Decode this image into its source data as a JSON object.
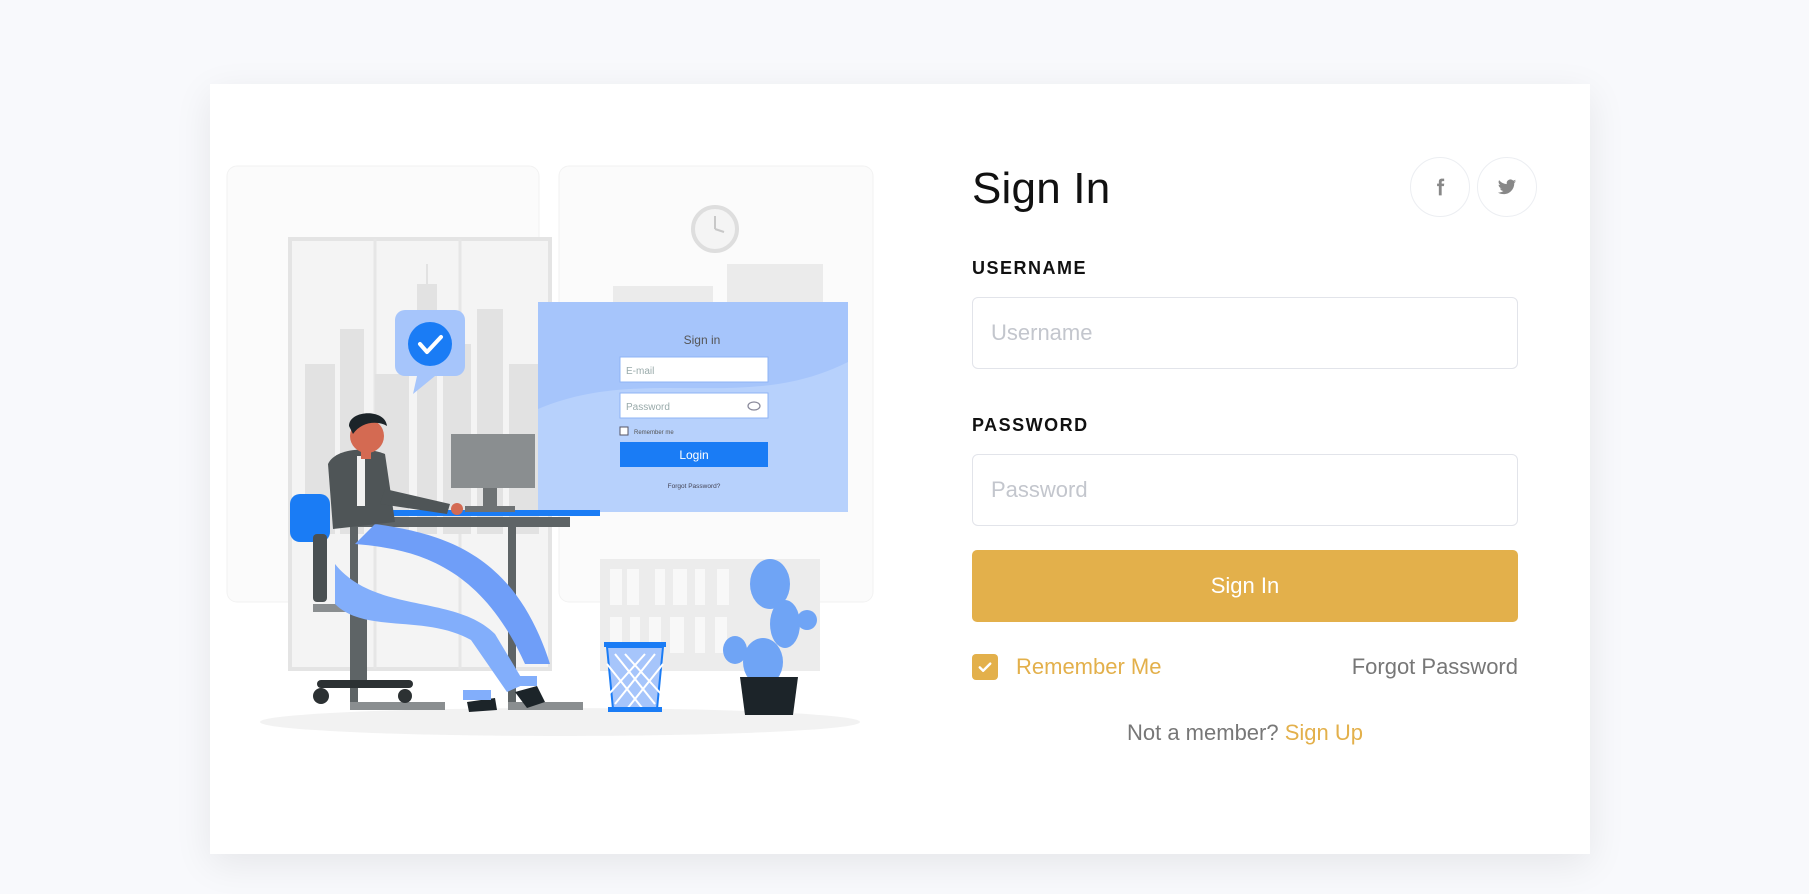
{
  "form": {
    "title": "Sign In",
    "username_label": "USERNAME",
    "username_placeholder": "Username",
    "username_value": "",
    "password_label": "PASSWORD",
    "password_placeholder": "Password",
    "password_value": "",
    "submit_label": "Sign In",
    "remember_label": "Remember Me",
    "remember_checked": true,
    "forgot_label": "Forgot Password",
    "signup_prompt": "Not a member?",
    "signup_label": "Sign Up"
  },
  "social": {
    "facebook_icon": "facebook-icon",
    "twitter_icon": "twitter-icon"
  },
  "illustration": {
    "window_title": "Sign in",
    "email_placeholder": "E-mail",
    "password_placeholder": "Password",
    "remember_text": "Remember me",
    "login_button": "Login",
    "forgot_text": "Forgot Password?"
  },
  "colors": {
    "accent": "#e3b04b",
    "illustration_blue": "#1a7cf5",
    "illustration_light_blue": "#a6c5fb",
    "background": "#f8f9fc"
  }
}
